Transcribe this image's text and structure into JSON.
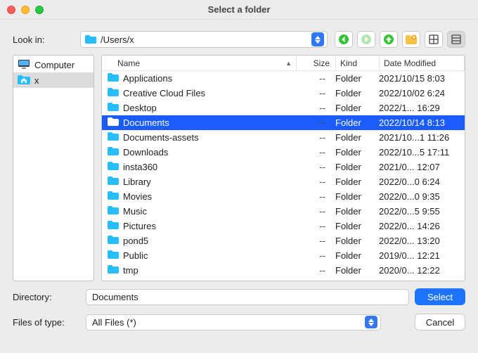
{
  "window": {
    "title": "Select a folder"
  },
  "toolbar": {
    "look_in_label": "Look in:",
    "path": "/Users/x"
  },
  "sidebar": {
    "items": [
      {
        "label": "Computer"
      },
      {
        "label": "x"
      }
    ]
  },
  "columns": {
    "name": "Name",
    "size": "Size",
    "kind": "Kind",
    "date": "Date Modified"
  },
  "files": [
    {
      "name": "Applications",
      "size": "--",
      "kind": "Folder",
      "date": "2021/10/15 8:03",
      "selected": false
    },
    {
      "name": "Creative Cloud Files",
      "size": "--",
      "kind": "Folder",
      "date": "2022/10/02 6:24",
      "selected": false
    },
    {
      "name": "Desktop",
      "size": "--",
      "kind": "Folder",
      "date": "2022/1... 16:29",
      "selected": false
    },
    {
      "name": "Documents",
      "size": "--",
      "kind": "Folder",
      "date": "2022/10/14 8:13",
      "selected": true
    },
    {
      "name": "Documents-assets",
      "size": "--",
      "kind": "Folder",
      "date": "2021/10...1 11:26",
      "selected": false
    },
    {
      "name": "Downloads",
      "size": "--",
      "kind": "Folder",
      "date": "2022/10...5 17:11",
      "selected": false
    },
    {
      "name": "insta360",
      "size": "--",
      "kind": "Folder",
      "date": "2021/0... 12:07",
      "selected": false
    },
    {
      "name": "Library",
      "size": "--",
      "kind": "Folder",
      "date": "2022/0...0 6:24",
      "selected": false
    },
    {
      "name": "Movies",
      "size": "--",
      "kind": "Folder",
      "date": "2022/0...0 9:35",
      "selected": false
    },
    {
      "name": "Music",
      "size": "--",
      "kind": "Folder",
      "date": "2022/0...5 9:55",
      "selected": false
    },
    {
      "name": "Pictures",
      "size": "--",
      "kind": "Folder",
      "date": "2022/0... 14:26",
      "selected": false
    },
    {
      "name": "pond5",
      "size": "--",
      "kind": "Folder",
      "date": "2022/0... 13:20",
      "selected": false
    },
    {
      "name": "Public",
      "size": "--",
      "kind": "Folder",
      "date": "2019/0... 12:21",
      "selected": false
    },
    {
      "name": "tmp",
      "size": "--",
      "kind": "Folder",
      "date": "2020/0... 12:22",
      "selected": false
    }
  ],
  "footer": {
    "directory_label": "Directory:",
    "directory_value": "Documents",
    "filter_label": "Files of type:",
    "filter_value": "All Files (*)",
    "select_label": "Select",
    "cancel_label": "Cancel"
  },
  "icons": {
    "folder_color": "#27bdff",
    "folder_selected_color": "#ffffff"
  }
}
